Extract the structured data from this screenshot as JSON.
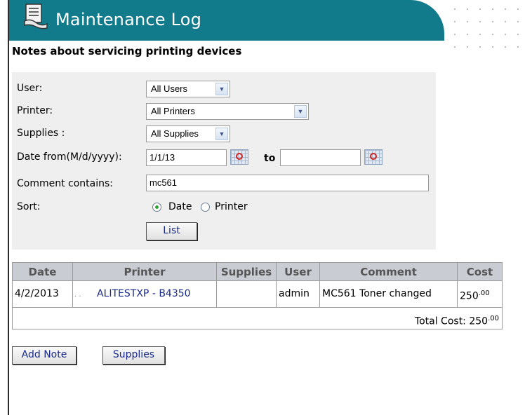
{
  "header": {
    "title": "Maintenance Log",
    "subtitle": "Notes about servicing printing devices",
    "icon": "log-document-icon"
  },
  "filters": {
    "user_label": "User:",
    "user_value": "All Users",
    "printer_label": "Printer:",
    "printer_value": "All Printers",
    "supplies_label": "Supplies :",
    "supplies_value": "All Supplies",
    "date_label": "Date from(M/d/yyyy):",
    "date_from": "1/1/13",
    "date_to_label": "to",
    "date_to": "",
    "comment_label": "Comment contains:",
    "comment_value": "mc561",
    "sort_label": "Sort:",
    "sort_options": [
      "Date",
      "Printer"
    ],
    "sort_selected": "Date",
    "list_button": "List"
  },
  "table": {
    "columns": [
      "Date",
      "Printer",
      "Supplies",
      "User",
      "Comment",
      "Cost"
    ],
    "rows": [
      {
        "date": "4/2/2013",
        "prefix": ". .",
        "printer": "ALITESTXP - B4350",
        "supplies": "",
        "user": "admin",
        "comment": "MC561 Toner changed",
        "cost": "250",
        "cost_cents": ".00"
      }
    ],
    "total_label": "Total Cost:",
    "total_value": "250",
    "total_cents": ".00"
  },
  "actions": {
    "add_note": "Add Note",
    "supplies": "Supplies"
  },
  "colors": {
    "banner": "#117a8b",
    "panel": "#efefef",
    "table_header": "#c9cdd3",
    "link": "#1a2a8a"
  }
}
